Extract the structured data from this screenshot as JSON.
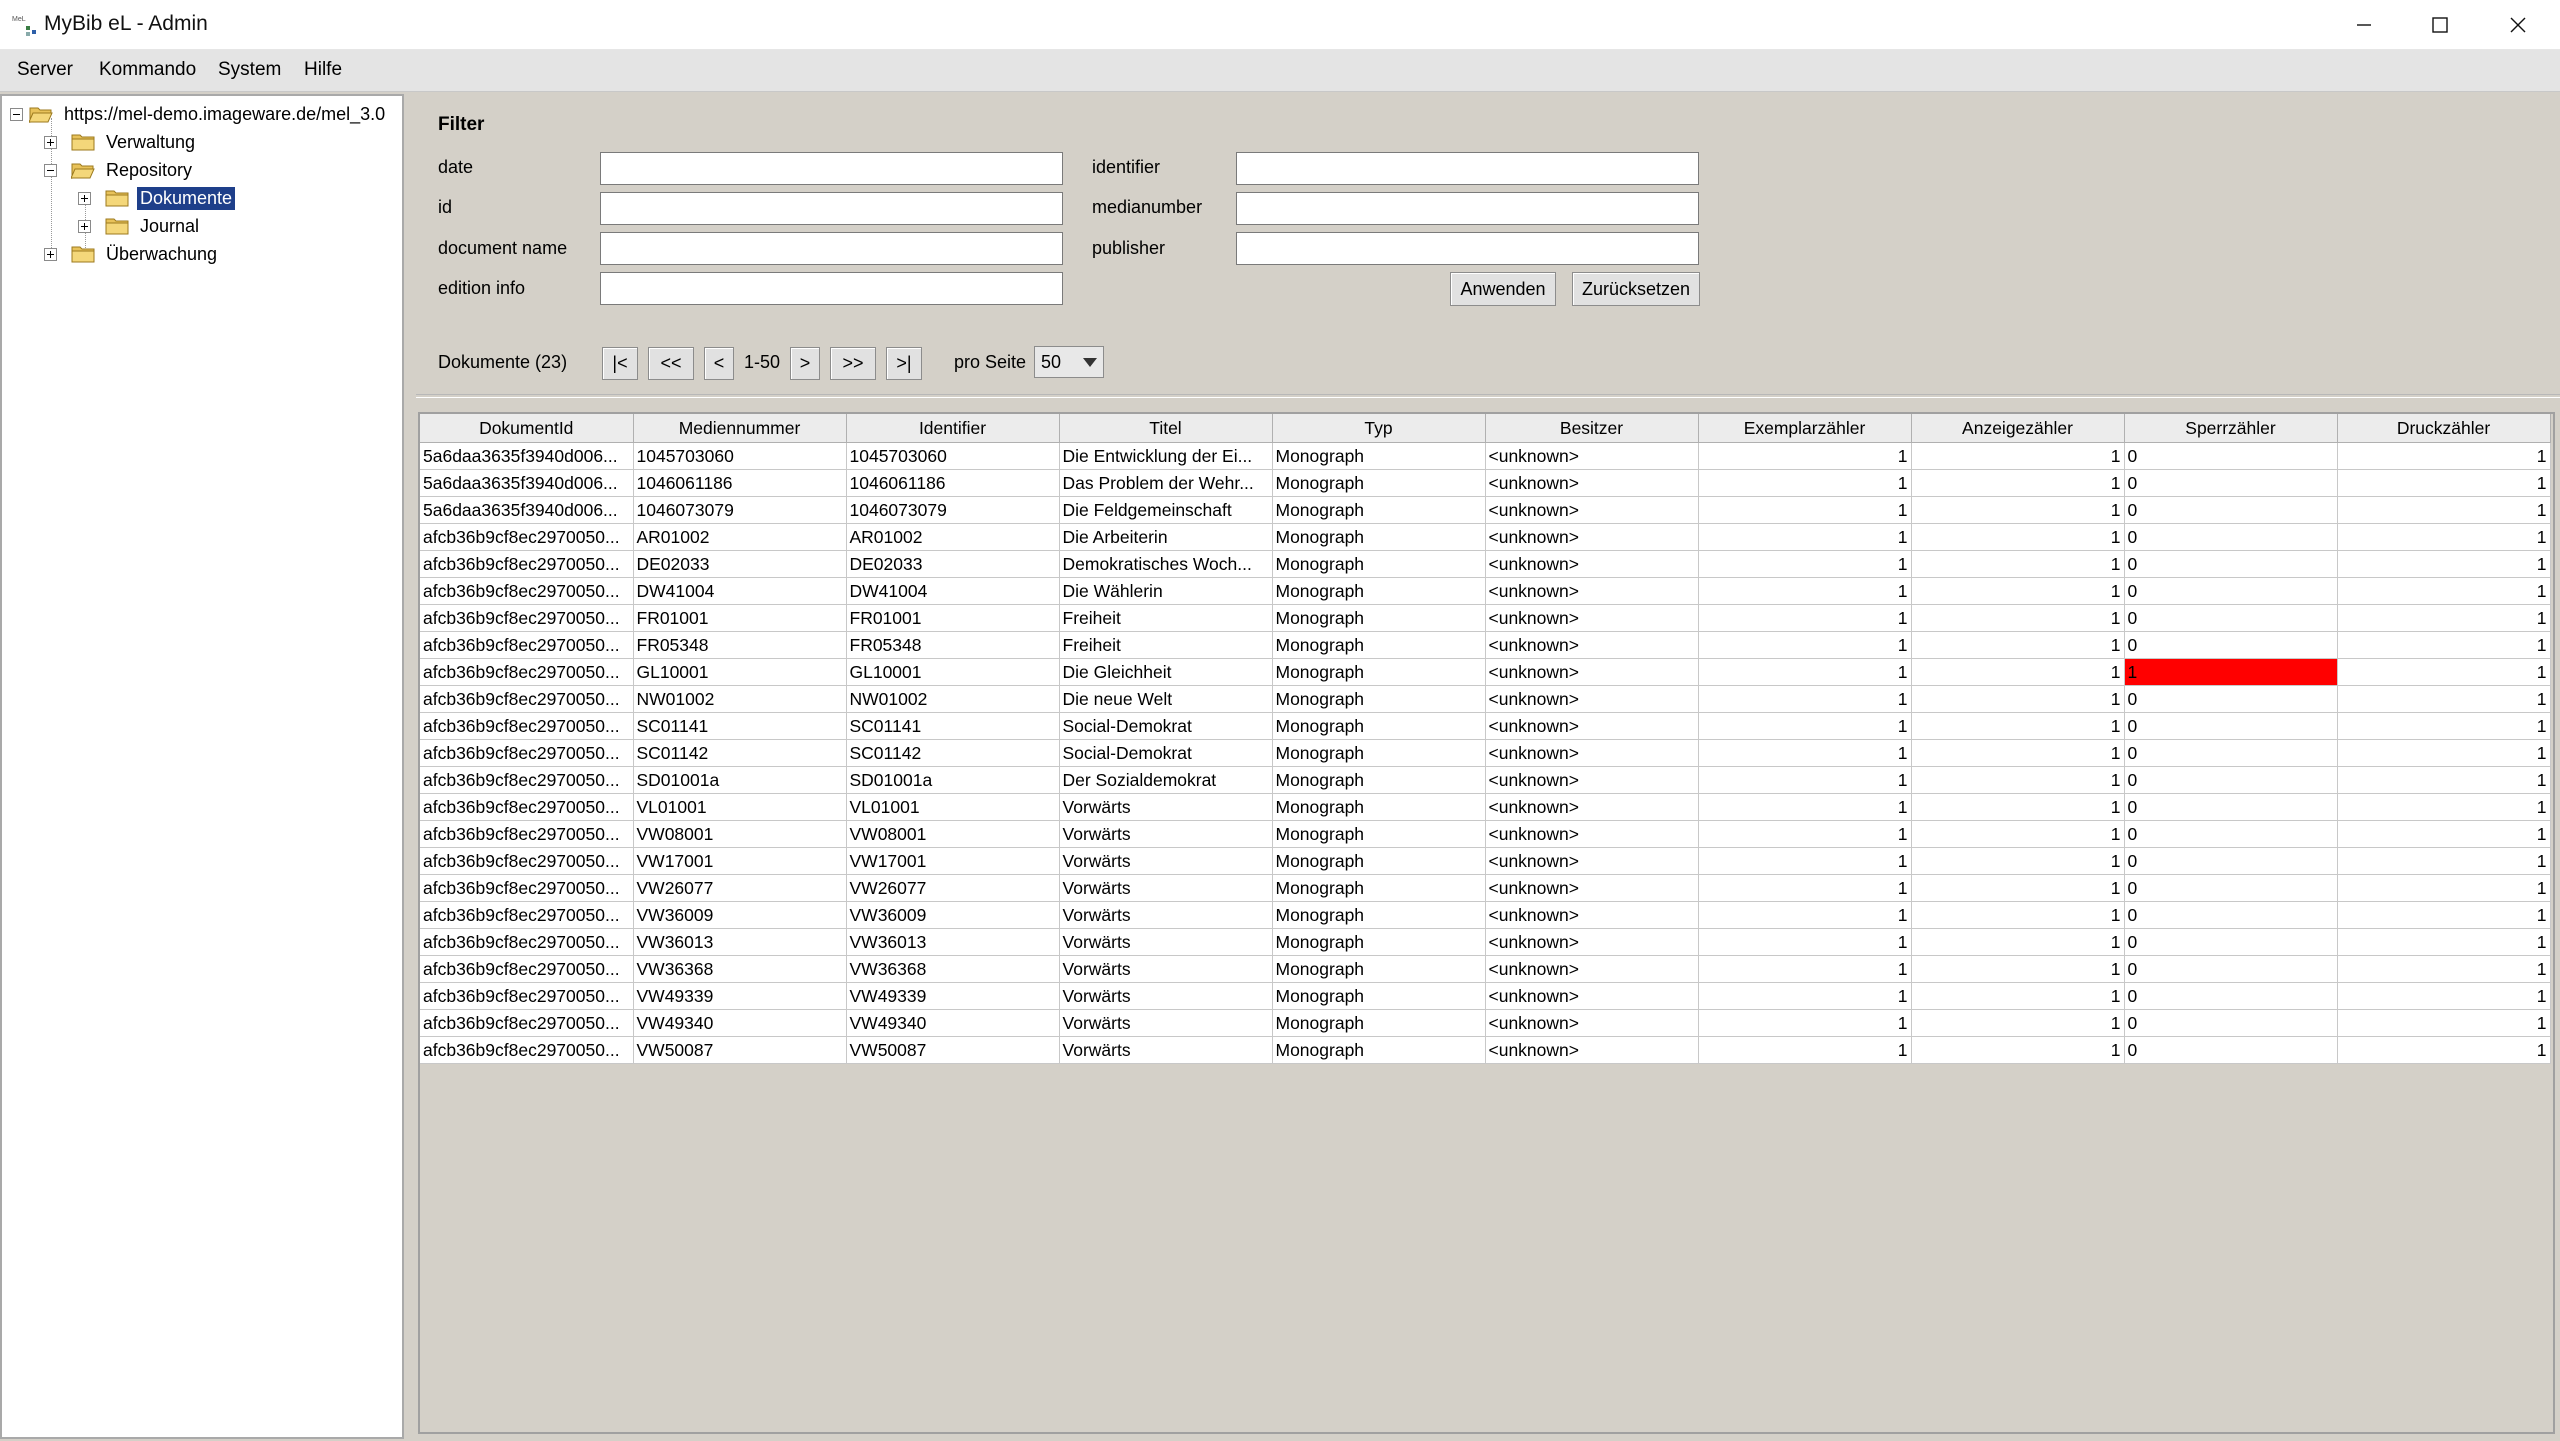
{
  "window": {
    "title": "MyBib eL - Admin",
    "icon": "mybib-app-icon",
    "controls": [
      "minimize-icon",
      "maximize-icon",
      "close-icon"
    ]
  },
  "menu": [
    "Server",
    "Kommando",
    "System",
    "Hilfe"
  ],
  "tree": {
    "root": "https://mel-demo.imageware.de/mel_3.0",
    "nodes": {
      "verwaltung": "Verwaltung",
      "repository": "Repository",
      "dokumente": "Dokumente",
      "journal": "Journal",
      "ueberwachung": "Überwachung"
    },
    "selected": "Dokumente"
  },
  "filter": {
    "title": "Filter",
    "fields": {
      "date": {
        "label": "date",
        "value": ""
      },
      "id": {
        "label": "id",
        "value": ""
      },
      "document_name": {
        "label": "document name",
        "value": ""
      },
      "edition_info": {
        "label": "edition info",
        "value": ""
      },
      "identifier": {
        "label": "identifier",
        "value": ""
      },
      "medianumber": {
        "label": "medianumber",
        "value": ""
      },
      "publisher": {
        "label": "publisher",
        "value": ""
      }
    },
    "apply_label": "Anwenden",
    "reset_label": "Zurücksetzen"
  },
  "pager": {
    "label": "Dokumente (23)",
    "first": "|<",
    "prev_page": "<<",
    "prev": "<",
    "range": "1-50",
    "next": ">",
    "next_page": ">>",
    "last": ">|",
    "per_page_label": "pro Seite",
    "per_page_value": "50"
  },
  "table": {
    "columns": [
      "DokumentId",
      "Mediennummer",
      "Identifier",
      "Titel",
      "Typ",
      "Besitzer",
      "Exemplarzähler",
      "Anzeigezähler",
      "Sperrzähler",
      "Druckzähler"
    ],
    "rows": [
      [
        "5a6daa3635f3940d006...",
        "1045703060",
        "1045703060",
        "Die Entwicklung der Ei...",
        "Monograph",
        "<unknown>",
        "1",
        "1",
        "0",
        "1"
      ],
      [
        "5a6daa3635f3940d006...",
        "1046061186",
        "1046061186",
        "Das Problem der Wehr...",
        "Monograph",
        "<unknown>",
        "1",
        "1",
        "0",
        "1"
      ],
      [
        "5a6daa3635f3940d006...",
        "1046073079",
        "1046073079",
        "Die Feldgemeinschaft",
        "Monograph",
        "<unknown>",
        "1",
        "1",
        "0",
        "1"
      ],
      [
        "afcb36b9cf8ec2970050...",
        "AR01002",
        "AR01002",
        "Die Arbeiterin",
        "Monograph",
        "<unknown>",
        "1",
        "1",
        "0",
        "1"
      ],
      [
        "afcb36b9cf8ec2970050...",
        "DE02033",
        "DE02033",
        "Demokratisches Woch...",
        "Monograph",
        "<unknown>",
        "1",
        "1",
        "0",
        "1"
      ],
      [
        "afcb36b9cf8ec2970050...",
        "DW41004",
        "DW41004",
        "Die Wählerin",
        "Monograph",
        "<unknown>",
        "1",
        "1",
        "0",
        "1"
      ],
      [
        "afcb36b9cf8ec2970050...",
        "FR01001",
        "FR01001",
        "Freiheit",
        "Monograph",
        "<unknown>",
        "1",
        "1",
        "0",
        "1"
      ],
      [
        "afcb36b9cf8ec2970050...",
        "FR05348",
        "FR05348",
        "Freiheit",
        "Monograph",
        "<unknown>",
        "1",
        "1",
        "0",
        "1"
      ],
      [
        "afcb36b9cf8ec2970050...",
        "GL10001",
        "GL10001",
        "Die Gleichheit",
        "Monograph",
        "<unknown>",
        "1",
        "1",
        "1",
        "1"
      ],
      [
        "afcb36b9cf8ec2970050...",
        "NW01002",
        "NW01002",
        "Die neue Welt",
        "Monograph",
        "<unknown>",
        "1",
        "1",
        "0",
        "1"
      ],
      [
        "afcb36b9cf8ec2970050...",
        "SC01141",
        "SC01141",
        "Social-Demokrat",
        "Monograph",
        "<unknown>",
        "1",
        "1",
        "0",
        "1"
      ],
      [
        "afcb36b9cf8ec2970050...",
        "SC01142",
        "SC01142",
        "Social-Demokrat",
        "Monograph",
        "<unknown>",
        "1",
        "1",
        "0",
        "1"
      ],
      [
        "afcb36b9cf8ec2970050...",
        "SD01001a",
        "SD01001a",
        "Der Sozialdemokrat",
        "Monograph",
        "<unknown>",
        "1",
        "1",
        "0",
        "1"
      ],
      [
        "afcb36b9cf8ec2970050...",
        "VL01001",
        "VL01001",
        "Vorwärts",
        "Monograph",
        "<unknown>",
        "1",
        "1",
        "0",
        "1"
      ],
      [
        "afcb36b9cf8ec2970050...",
        "VW08001",
        "VW08001",
        "Vorwärts",
        "Monograph",
        "<unknown>",
        "1",
        "1",
        "0",
        "1"
      ],
      [
        "afcb36b9cf8ec2970050...",
        "VW17001",
        "VW17001",
        "Vorwärts",
        "Monograph",
        "<unknown>",
        "1",
        "1",
        "0",
        "1"
      ],
      [
        "afcb36b9cf8ec2970050...",
        "VW26077",
        "VW26077",
        "Vorwärts",
        "Monograph",
        "<unknown>",
        "1",
        "1",
        "0",
        "1"
      ],
      [
        "afcb36b9cf8ec2970050...",
        "VW36009",
        "VW36009",
        "Vorwärts",
        "Monograph",
        "<unknown>",
        "1",
        "1",
        "0",
        "1"
      ],
      [
        "afcb36b9cf8ec2970050...",
        "VW36013",
        "VW36013",
        "Vorwärts",
        "Monograph",
        "<unknown>",
        "1",
        "1",
        "0",
        "1"
      ],
      [
        "afcb36b9cf8ec2970050...",
        "VW36368",
        "VW36368",
        "Vorwärts",
        "Monograph",
        "<unknown>",
        "1",
        "1",
        "0",
        "1"
      ],
      [
        "afcb36b9cf8ec2970050...",
        "VW49339",
        "VW49339",
        "Vorwärts",
        "Monograph",
        "<unknown>",
        "1",
        "1",
        "0",
        "1"
      ],
      [
        "afcb36b9cf8ec2970050...",
        "VW49340",
        "VW49340",
        "Vorwärts",
        "Monograph",
        "<unknown>",
        "1",
        "1",
        "0",
        "1"
      ],
      [
        "afcb36b9cf8ec2970050...",
        "VW50087",
        "VW50087",
        "Vorwärts",
        "Monograph",
        "<unknown>",
        "1",
        "1",
        "0",
        "1"
      ]
    ],
    "flagged_row_index": 8,
    "flag_color": "#ff0000",
    "selection_color": "#1e3f8a"
  }
}
